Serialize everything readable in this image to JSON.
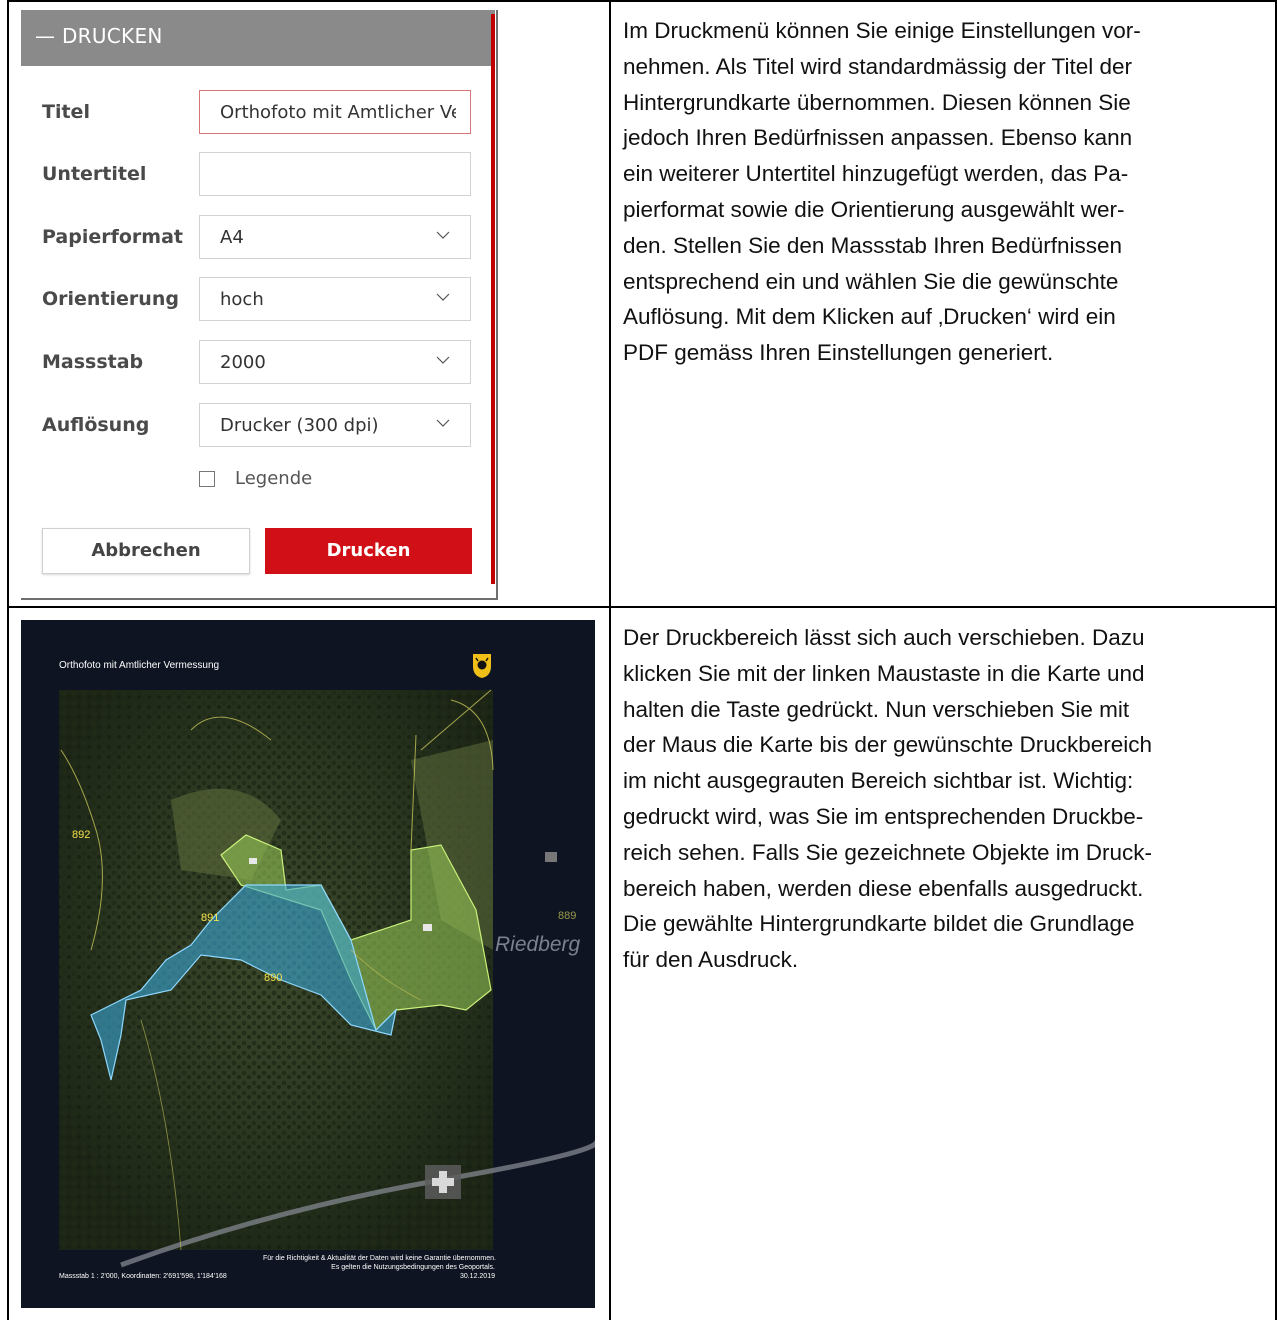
{
  "print_panel": {
    "header": "— DRUCKEN",
    "fields": [
      {
        "label": "Titel",
        "value": "Orthofoto mit Amtlicher Vermessung"
      },
      {
        "label": "Untertitel",
        "value": ""
      },
      {
        "label": "Papierformat",
        "value": "A4"
      },
      {
        "label": "Orientierung",
        "value": "hoch"
      },
      {
        "label": "Massstab",
        "value": "2000"
      },
      {
        "label": "Auflösung",
        "value": "Drucker (300 dpi)"
      }
    ],
    "legend_label": "Legende",
    "legend_checked": false,
    "cancel_label": "Abbrechen",
    "print_label": "Drucken",
    "colors": {
      "header": "#8a8a8a",
      "print_button": "#d10f16"
    }
  },
  "text_top": [
    "Im Druckmenü können Sie einige Einstellungen vor-",
    "nehmen. Als Titel wird standardmässig der Titel der",
    "Hintergrundkarte übernommen. Diesen können Sie",
    "jedoch Ihren Bedürfnissen anpassen. Ebenso kann",
    "ein weiterer Untertitel hinzugefügt werden, das Pa-",
    "pierformat sowie die Orientierung ausgewählt wer-",
    "den. Stellen Sie den Massstab Ihren Bedürfnissen",
    "entsprechend ein und wählen Sie die gewünschte",
    "Auflösung. Mit dem Klicken auf ‚Drucken‘ wird ein",
    "PDF gemäss Ihren Einstellungen generiert."
  ],
  "text_bottom": [
    "Der Druckbereich lässt sich auch verschieben. Dazu",
    "klicken Sie mit der linken Maustaste in die Karte und",
    "halten die Taste gedrückt. Nun verschieben Sie mit",
    "der Maus die Karte bis der gewünschte Druckbereich",
    "im nicht ausgegrauten Bereich sichtbar ist. Wichtig:",
    "gedruckt wird, was Sie im entsprechenden Druckbe-",
    "reich sehen. Falls Sie gezeichnete Objekte im Druck-",
    "bereich haben, werden diese ebenfalls ausgedruckt.",
    "Die gewählte Hintergrundkarte bildet die Grundlage",
    "für den Ausdruck."
  ],
  "map_preview": {
    "title": "Orthofoto mit Amtlicher Vermessung",
    "parcels": [
      "892",
      "891",
      "890",
      "889"
    ],
    "place_name": "Riedberg",
    "disclaimer_1": "Für die Richtigkeit & Aktualität der Daten wird keine Garantie übernommen.",
    "disclaimer_2": "Es gelten die Nutzungsbedingungen des Geoportals.",
    "date": "30.12.2019",
    "scale_info": "Massstab 1 : 2'000, Koordinaten: 2'691'598, 1'184'168"
  }
}
